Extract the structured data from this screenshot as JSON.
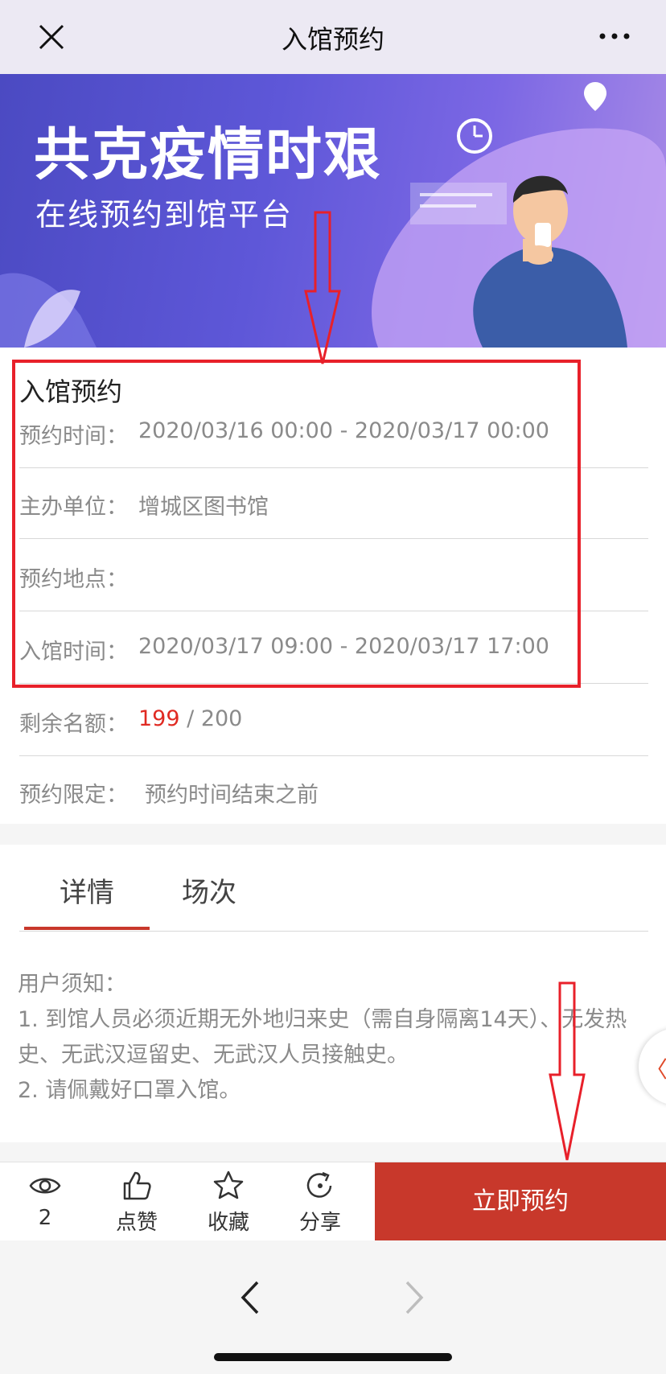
{
  "window": {
    "title": "入馆预约"
  },
  "banner": {
    "headline": "共克疫情时艰",
    "subline": "在线预约到馆平台"
  },
  "info": {
    "title": "入馆预约",
    "rows": [
      {
        "label": "预约时间：",
        "value": "2020/03/16 00:00 - 2020/03/17 00:00"
      },
      {
        "label": "主办单位：",
        "value": "增城区图书馆"
      },
      {
        "label": "预约地点：",
        "value": ""
      },
      {
        "label": "入馆时间：",
        "value": "2020/03/17 09:00 - 2020/03/17 17:00"
      },
      {
        "label": "剩余名额：",
        "remaining": "199",
        "total": "/ 200"
      },
      {
        "label": "预约限定：",
        "value": "预约时间结束之前"
      }
    ]
  },
  "tabs": [
    {
      "label": "详情",
      "active": true
    },
    {
      "label": "场次",
      "active": false
    }
  ],
  "notice": {
    "heading": "用户须知：",
    "line1": "1. 到馆人员必须近期无外地归来史（需自身隔离14天）、无发热史、无武汉逗留史、无武汉人员接触史。",
    "line2": "2. 请佩戴好口罩入馆。"
  },
  "side_tab": {
    "glyph": "〈"
  },
  "actions": {
    "views": {
      "count": "2",
      "icon": "eye-icon"
    },
    "like": {
      "label": "点赞",
      "icon": "thumbs-up-icon"
    },
    "favorite": {
      "label": "收藏",
      "icon": "star-icon"
    },
    "share": {
      "label": "分享",
      "icon": "share-icon"
    },
    "book": {
      "label": "立即预约"
    }
  },
  "colors": {
    "accent": "#c8382b",
    "highlight_red": "#e02a22",
    "annotation": "#e8202a"
  }
}
